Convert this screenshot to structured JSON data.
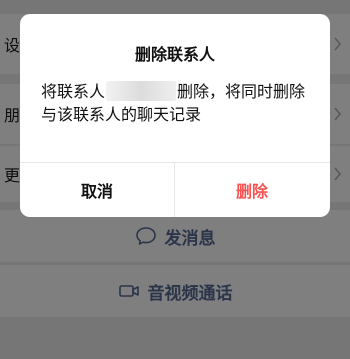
{
  "background": {
    "rows": [
      {
        "edge_char": "设"
      },
      {
        "edge_char": "朋"
      },
      {
        "edge_char": "更"
      }
    ],
    "send_message": {
      "label": "发消息",
      "icon": "chat-bubble-icon"
    },
    "video_call": {
      "label": "音视频通话",
      "icon": "video-camera-icon"
    }
  },
  "dialog": {
    "title": "删除联系人",
    "body_prefix": "将联系人",
    "body_suffix": "删除，将同时删除与该联系人的聊天记录",
    "cancel_label": "取消",
    "delete_label": "删除"
  },
  "colors": {
    "link": "#576b95",
    "danger": "#fa5151",
    "overlay": "rgba(0,0,0,0.5)"
  }
}
